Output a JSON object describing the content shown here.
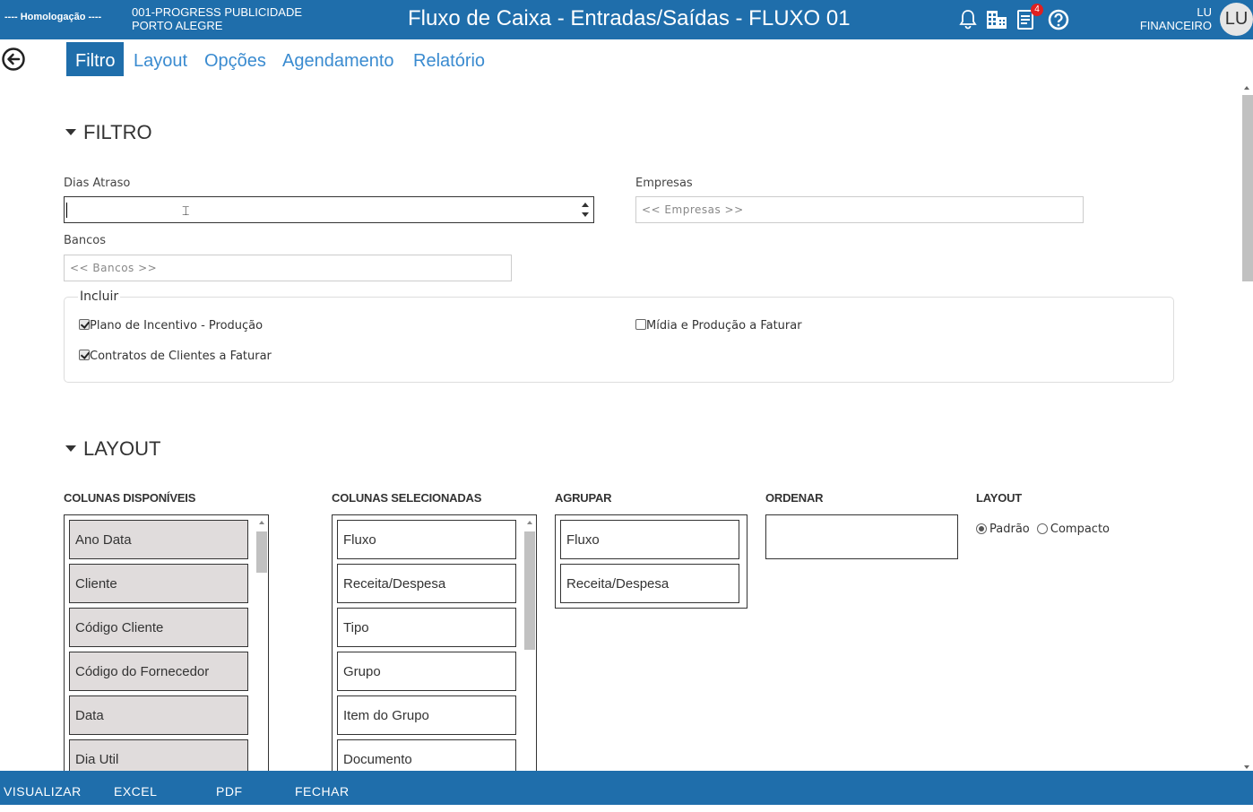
{
  "header": {
    "environment": "---- Homologação ----",
    "company_line1": "001-PROGRESS PUBLICIDADE",
    "company_line2": "PORTO ALEGRE",
    "title": "Fluxo de Caixa - Entradas/Saídas - FLUXO 01",
    "notification_count": "4",
    "user_name": "LU",
    "user_role": "FINANCEIRO",
    "avatar_initials": "LU"
  },
  "tabs": [
    {
      "label": "Filtro",
      "active": true
    },
    {
      "label": "Layout"
    },
    {
      "label": "Opções"
    },
    {
      "label": "Agendamento"
    },
    {
      "label": "Relatório"
    }
  ],
  "filtro": {
    "section_title": "FILTRO",
    "dias_atraso_label": "Dias Atraso",
    "dias_atraso_value": "",
    "empresas_label": "Empresas",
    "empresas_placeholder": "<< Empresas >>",
    "bancos_label": "Bancos",
    "bancos_placeholder": "<< Bancos >>",
    "incluir_legend": "Incluir",
    "checkboxes": [
      {
        "label": "Plano de Incentivo - Produção",
        "checked": true
      },
      {
        "label": "Mídia e Produção a Faturar",
        "checked": false
      },
      {
        "label": "Contratos de Clientes a Faturar",
        "checked": true
      }
    ]
  },
  "layout": {
    "section_title": "LAYOUT",
    "colunas_disponiveis_label": "COLUNAS DISPONÍVEIS",
    "colunas_disponiveis": [
      "Ano Data",
      "Cliente",
      "Código Cliente",
      "Código do Fornecedor",
      "Data",
      "Dia Util"
    ],
    "colunas_selecionadas_label": "COLUNAS SELECIONADAS",
    "colunas_selecionadas": [
      "Fluxo",
      "Receita/Despesa",
      "Tipo",
      "Grupo",
      "Item do Grupo",
      "Documento"
    ],
    "agrupar_label": "AGRUPAR",
    "agrupar": [
      "Fluxo",
      "Receita/Despesa"
    ],
    "ordenar_label": "ORDENAR",
    "layout_label": "LAYOUT",
    "layout_options": [
      {
        "label": "Padrão",
        "selected": true
      },
      {
        "label": "Compacto",
        "selected": false
      }
    ]
  },
  "footer": {
    "visualizar": "VISUALIZAR",
    "excel": "EXCEL",
    "pdf": "PDF",
    "fechar": "FECHAR"
  },
  "colors": {
    "primary": "#1f6eab",
    "link": "#3a8bd0",
    "badge": "#e02020",
    "list_item_grey": "#e0dcdc"
  }
}
